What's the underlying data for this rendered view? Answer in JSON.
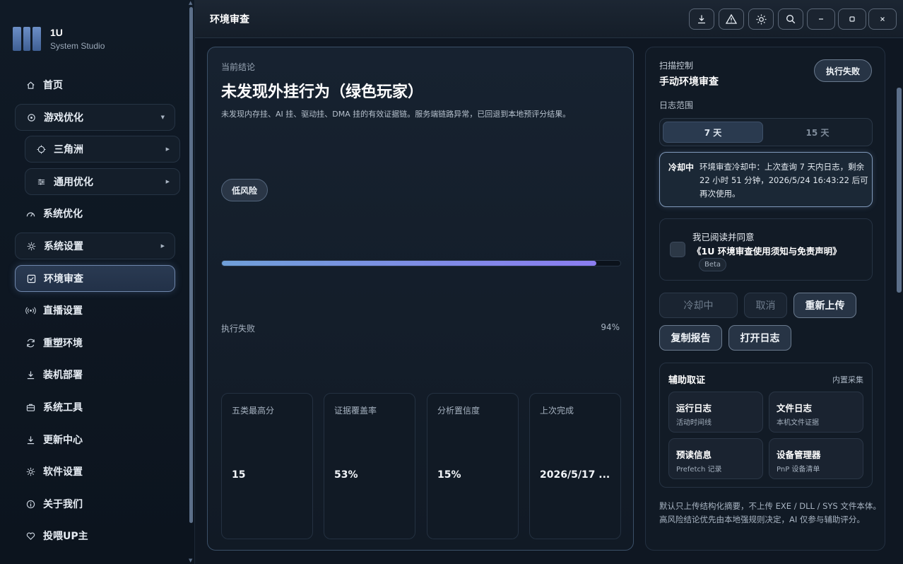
{
  "app": {
    "name": "1U",
    "subtitle": "System Studio"
  },
  "sidebar": {
    "items": [
      {
        "label": "首页",
        "icon": "home-icon"
      },
      {
        "label": "游戏优化",
        "icon": "gamepad-icon"
      },
      {
        "label": "三角洲",
        "icon": "crosshair-icon"
      },
      {
        "label": "通用优化",
        "icon": "sliders-icon"
      },
      {
        "label": "系统优化",
        "icon": "gauge-icon"
      },
      {
        "label": "系统设置",
        "icon": "gear-icon"
      },
      {
        "label": "环境审查",
        "icon": "checkbox-icon"
      },
      {
        "label": "直播设置",
        "icon": "broadcast-icon"
      },
      {
        "label": "重塑环境",
        "icon": "refresh-icon"
      },
      {
        "label": "装机部署",
        "icon": "download-icon"
      },
      {
        "label": "系统工具",
        "icon": "toolbox-icon"
      },
      {
        "label": "更新中心",
        "icon": "download-icon"
      },
      {
        "label": "软件设置",
        "icon": "gear-icon"
      },
      {
        "label": "关于我们",
        "icon": "info-icon"
      },
      {
        "label": "投喂UP主",
        "icon": "heart-icon"
      }
    ]
  },
  "header": {
    "title": "环境审查"
  },
  "verdict": {
    "label": "当前结论",
    "title": "未发现外挂行为（绿色玩家）",
    "description": "未发现内存挂、AI 挂、驱动挂、DMA 挂的有效证据链。服务端链路异常，已回退到本地预评分结果。",
    "risk": "低风险",
    "progress_label": "执行失败",
    "progress_pct_text": "94%",
    "progress_value": 0.94
  },
  "stats": [
    {
      "label": "五类最高分",
      "value": "15"
    },
    {
      "label": "证据覆盖率",
      "value": "53%"
    },
    {
      "label": "分析置信度",
      "value": "15%"
    },
    {
      "label": "上次完成",
      "value": "2026/5/17 ..."
    }
  ],
  "scan": {
    "section_label": "扫描控制",
    "title": "手动环境审查",
    "status_button": "执行失败",
    "range_label": "日志范围",
    "range_options": [
      "7 天",
      "15 天"
    ],
    "range_selected": "7 天",
    "notice_tag": "冷却中",
    "notice_text": "环境审查冷却中：上次查询 7 天内日志，剩余 22 小时 51 分钟，2026/5/24 16:43:22 后可再次使用。",
    "agree_line1": "我已阅读并同意",
    "agree_line2": "《1U 环境审查使用须知与免责声明》",
    "agree_badge": "Beta",
    "buttons": {
      "cooldown": "冷却中",
      "cancel": "取消",
      "reupload": "重新上传",
      "copy_report": "复制报告",
      "open_log": "打开日志"
    }
  },
  "aux": {
    "title": "辅助取证",
    "tag": "内置采集",
    "tiles": [
      {
        "title": "运行日志",
        "desc": "活动时间线"
      },
      {
        "title": "文件日志",
        "desc": "本机文件证据"
      },
      {
        "title": "预读信息",
        "desc": "Prefetch 记录"
      },
      {
        "title": "设备管理器",
        "desc": "PnP 设备清单"
      }
    ]
  },
  "footer_note": "默认只上传结构化摘要，不上传 EXE / DLL / SYS 文件本体。高风险结论优先由本地强规则决定，AI 仅参与辅助评分。"
}
